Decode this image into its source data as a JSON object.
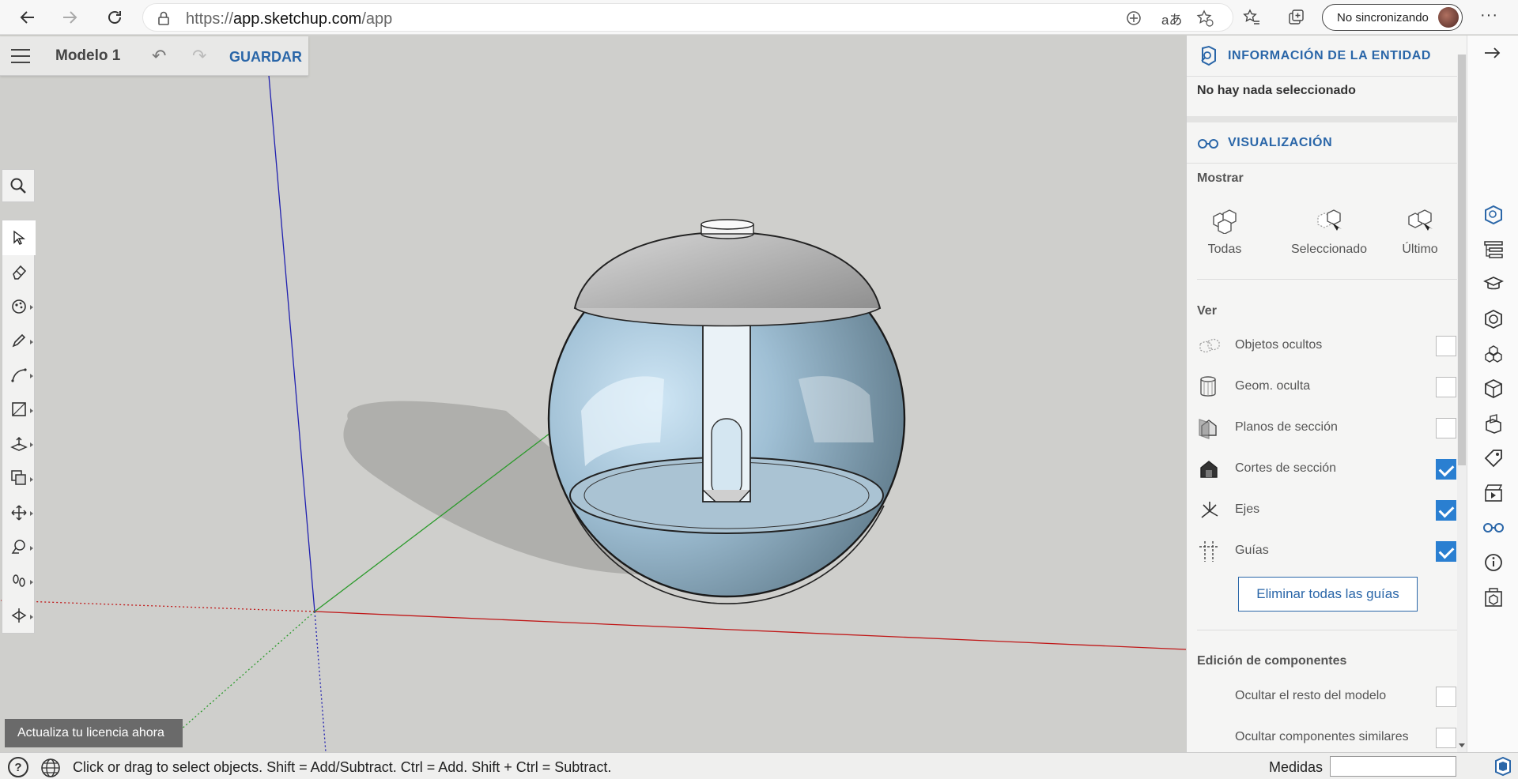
{
  "browser": {
    "url_scheme": "https://",
    "url_host": "app.sketchup.com",
    "url_path": "/app",
    "sync_label": "No sincronizando"
  },
  "app": {
    "model_name": "Modelo 1",
    "save_label": "GUARDAR"
  },
  "toolbar": {
    "tools": [
      "select-tool",
      "eraser-tool",
      "paint-bucket-tool",
      "pencil-tool",
      "arc-tool",
      "rectangle-tool",
      "push-pull-tool",
      "offset-tool",
      "move-tool",
      "tape-measure-tool",
      "walk-tool",
      "section-plane-tool"
    ],
    "active_tool": "select-tool"
  },
  "license": {
    "label": "Actualiza tu licencia ahora"
  },
  "status": {
    "hint": "Click or drag to select objects. Shift = Add/Subtract. Ctrl = Add. Shift + Ctrl = Subtract.",
    "measure_label": "Medidas",
    "measure_value": ""
  },
  "panel": {
    "entity_title": "INFORMACIÓN DE LA ENTIDAD",
    "entity_status": "No hay nada seleccionado",
    "view_title": "VISUALIZACIÓN",
    "show_label": "Mostrar",
    "show_options": [
      "Todas",
      "Seleccionado",
      "Último"
    ],
    "ver_label": "Ver",
    "ver_rows": [
      {
        "label": "Objetos ocultos",
        "checked": false,
        "icon": "hidden-objects-icon"
      },
      {
        "label": "Geom. oculta",
        "checked": false,
        "icon": "hidden-geometry-icon"
      },
      {
        "label": "Planos de sección",
        "checked": false,
        "icon": "section-planes-icon"
      },
      {
        "label": "Cortes de sección",
        "checked": true,
        "icon": "section-cuts-icon"
      },
      {
        "label": "Ejes",
        "checked": true,
        "icon": "axes-icon"
      },
      {
        "label": "Guías",
        "checked": true,
        "icon": "guides-icon"
      }
    ],
    "clear_guides_label": "Eliminar todas las guías",
    "component_edit_label": "Edición de componentes",
    "component_rows": [
      {
        "label": "Ocultar el resto del modelo",
        "checked": false
      },
      {
        "label": "Ocultar componentes similares",
        "checked": false
      }
    ]
  },
  "strip": {
    "icons": [
      "entity-info-icon",
      "outliner-icon",
      "instructor-icon",
      "materials-icon",
      "components-icon",
      "styles-icon",
      "solid-tools-icon",
      "tags-icon",
      "scenes-icon",
      "display-icon",
      "model-info-icon",
      "extension-icon"
    ],
    "active": "display-icon"
  },
  "colors": {
    "accent": "#2a66a8",
    "checkbox": "#2a7fd1",
    "axis_red": "#c01818",
    "axis_green": "#2a9a2a",
    "axis_blue": "#1a1aa0"
  }
}
